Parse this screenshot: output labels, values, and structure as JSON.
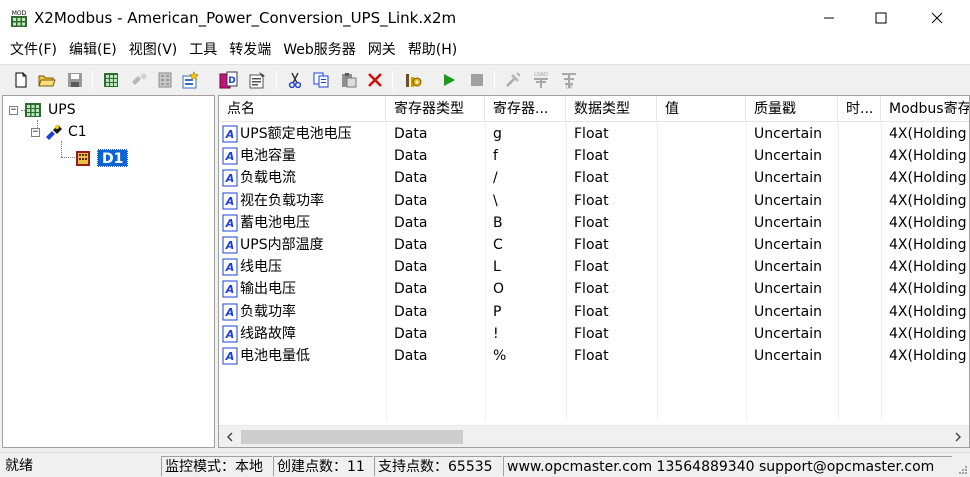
{
  "window": {
    "title": "X2Modbus - American_Power_Conversion_UPS_Link.x2m",
    "app_icon_label": "MOD"
  },
  "menu": [
    "文件(F)",
    "编辑(E)",
    "视图(V)",
    "工具",
    "转发端",
    "Web服务器",
    "网关",
    "帮助(H)"
  ],
  "toolbar": {
    "buttons": [
      "new-file-icon",
      "open-folder-icon",
      "save-icon",
      "add-channel-icon",
      "channel-properties-icon",
      "add-device-icon",
      "add-data-icon",
      "add-data-batch-icon",
      "properties-icon",
      "cut-icon",
      "copy-icon",
      "paste-icon",
      "delete-icon",
      "tools-icon",
      "run-icon",
      "stop-icon",
      "build-icon",
      "load-icon",
      "upload-icon"
    ],
    "colors": {
      "run": "#1a9c1a",
      "delete": "#d01010",
      "disabled": "#a0a0a0"
    }
  },
  "tree": {
    "root": "UPS",
    "channel": "C1",
    "device": "D1",
    "expander_minus": "−"
  },
  "list": {
    "columns": [
      "点名",
      "寄存器类型",
      "寄存器...",
      "数据类型",
      "值",
      "质量戳",
      "时...",
      "Modbus寄存器"
    ],
    "rows": [
      {
        "name": "UPS额定电池电压",
        "reg_type": "Data",
        "reg": "g",
        "data_type": "Float",
        "value": "",
        "quality": "Uncertain",
        "time": "",
        "modbus": "4X(Holding"
      },
      {
        "name": "电池容量",
        "reg_type": "Data",
        "reg": "f",
        "data_type": "Float",
        "value": "",
        "quality": "Uncertain",
        "time": "",
        "modbus": "4X(Holding"
      },
      {
        "name": "负载电流",
        "reg_type": "Data",
        "reg": "/",
        "data_type": "Float",
        "value": "",
        "quality": "Uncertain",
        "time": "",
        "modbus": "4X(Holding"
      },
      {
        "name": "视在负载功率",
        "reg_type": "Data",
        "reg": "\\",
        "data_type": "Float",
        "value": "",
        "quality": "Uncertain",
        "time": "",
        "modbus": "4X(Holding"
      },
      {
        "name": "蓄电池电压",
        "reg_type": "Data",
        "reg": "B",
        "data_type": "Float",
        "value": "",
        "quality": "Uncertain",
        "time": "",
        "modbus": "4X(Holding"
      },
      {
        "name": "UPS内部温度",
        "reg_type": "Data",
        "reg": "C",
        "data_type": "Float",
        "value": "",
        "quality": "Uncertain",
        "time": "",
        "modbus": "4X(Holding"
      },
      {
        "name": "线电压",
        "reg_type": "Data",
        "reg": "L",
        "data_type": "Float",
        "value": "",
        "quality": "Uncertain",
        "time": "",
        "modbus": "4X(Holding"
      },
      {
        "name": "输出电压",
        "reg_type": "Data",
        "reg": "O",
        "data_type": "Float",
        "value": "",
        "quality": "Uncertain",
        "time": "",
        "modbus": "4X(Holding"
      },
      {
        "name": "负载功率",
        "reg_type": "Data",
        "reg": "P",
        "data_type": "Float",
        "value": "",
        "quality": "Uncertain",
        "time": "",
        "modbus": "4X(Holding"
      },
      {
        "name": "线路故障",
        "reg_type": "Data",
        "reg": "!",
        "data_type": "Float",
        "value": "",
        "quality": "Uncertain",
        "time": "",
        "modbus": "4X(Holding"
      },
      {
        "name": "电池电量低",
        "reg_type": "Data",
        "reg": "%",
        "data_type": "Float",
        "value": "",
        "quality": "Uncertain",
        "time": "",
        "modbus": "4X(Holding"
      }
    ],
    "data_icon_label": "A",
    "data_icon_color": "#1c3fd8"
  },
  "statusbar": {
    "ready": "就绪",
    "mode": "监控模式：本地",
    "created_points": "创建点数：11",
    "supported_points": "支持点数：65535",
    "contact": "www.opcmaster.com 13564889340 support@opcmaster.com"
  }
}
